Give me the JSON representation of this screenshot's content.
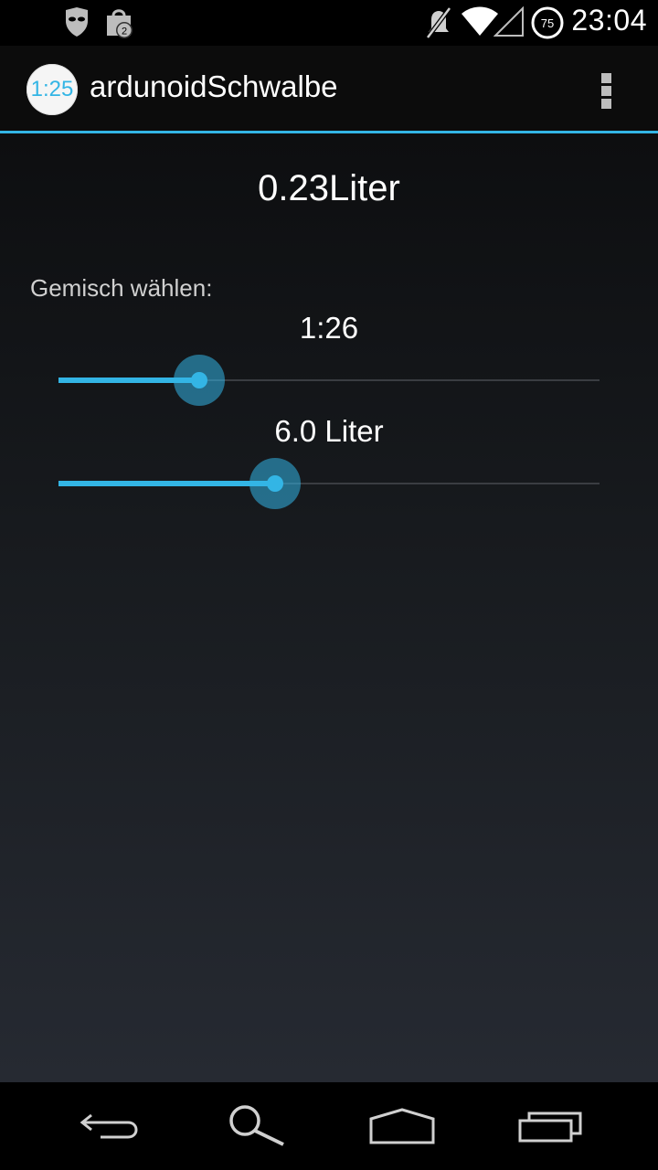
{
  "status_bar": {
    "time": "23:04",
    "notification_count": "2",
    "battery_level": "75",
    "icons": [
      "ghost-mask-icon",
      "shopping-bag-icon",
      "mute-icon",
      "wifi-icon",
      "signal-icon",
      "battery-icon"
    ]
  },
  "action_bar": {
    "app_icon_text": "1:25",
    "title": "ardunoidSchwalbe",
    "overflow_icon": "overflow-menu-icon"
  },
  "main": {
    "result": "0.23Liter",
    "mix_label": "Gemisch wählen:",
    "ratio_value": "1:26",
    "volume_value": "6.0 Liter",
    "ratio_slider_fraction": 0.26,
    "volume_slider_fraction": 0.4
  },
  "nav_bar": {
    "buttons": [
      "back-icon",
      "search-icon",
      "home-icon",
      "recent-apps-icon"
    ]
  },
  "colors": {
    "accent": "#33b5e5",
    "background_top": "#0d0e10",
    "background_bottom": "#262a32"
  }
}
